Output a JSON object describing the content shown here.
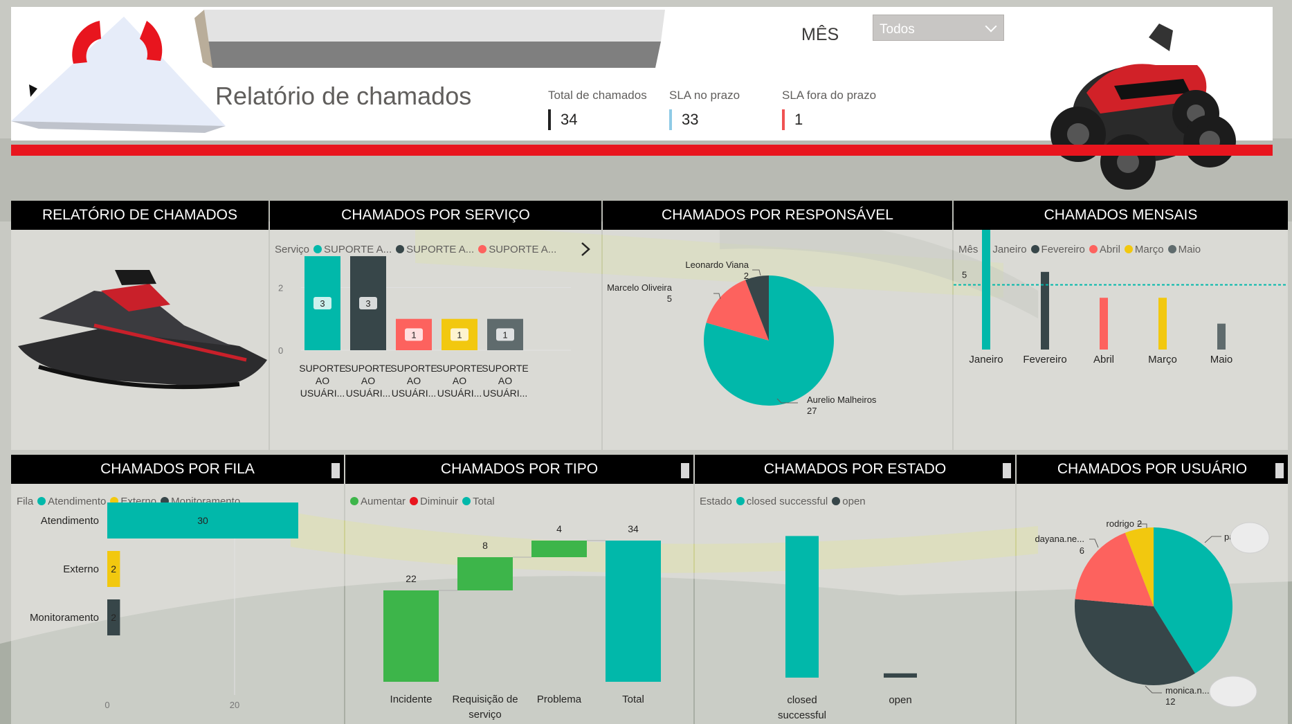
{
  "header": {
    "title": "Relatório de chamados",
    "kpis": [
      {
        "label": "Total de chamados",
        "value": "34",
        "color": "#222222"
      },
      {
        "label": "SLA no prazo",
        "value": "33",
        "color": "#8fcbe6"
      },
      {
        "label": "SLA fora do prazo",
        "value": "1",
        "color": "#f05252"
      }
    ],
    "month_filter": {
      "label": "MÊS",
      "selected": "Todos"
    }
  },
  "colors": {
    "teal": "#01b8aa",
    "dark": "#374649",
    "red": "#fd625e",
    "yellow": "#f2c80f",
    "gray": "#5f6b6d",
    "green": "#3db54a",
    "accent_red": "#e8151e"
  },
  "panels": {
    "jetski": {
      "title": "RELATÓRIO DE CHAMADOS",
      "icon": "jetski-image"
    },
    "servico": {
      "title": "CHAMADOS POR SERVIÇO",
      "legend_title": "Serviço",
      "legend": [
        "SUPORTE A...",
        "SUPORTE A...",
        "SUPORTE A..."
      ]
    },
    "responsavel": {
      "title": "CHAMADOS POR RESPONSÁVEL"
    },
    "mensais": {
      "title": "CHAMADOS MENSAIS",
      "legend_title": "Mês",
      "legend": [
        "Janeiro",
        "Fevereiro",
        "Abril",
        "Março",
        "Maio"
      ]
    },
    "fila": {
      "title": "CHAMADOS POR FILA",
      "legend_title": "Fila",
      "legend": [
        "Atendimento",
        "Externo",
        "Monitoramento"
      ]
    },
    "tipo": {
      "title": "CHAMADOS POR TIPO",
      "legend": [
        "Aumentar",
        "Diminuir",
        "Total"
      ]
    },
    "estado": {
      "title": "CHAMADOS POR ESTADO",
      "legend_title": "Estado",
      "legend": [
        "closed successful",
        "open"
      ]
    },
    "usuario": {
      "title": "CHAMADOS POR USUÁRIO"
    }
  },
  "chart_data": [
    {
      "id": "servico",
      "type": "bar",
      "categories": [
        "SUPORTE AO USUÁRI...",
        "SUPORTE AO USUÁRI...",
        "SUPORTE AO USUÁRI...",
        "SUPORTE AO USUÁRI...",
        "SUPORTE AO USUÁRI..."
      ],
      "category_lines": [
        [
          "SUPORTE",
          "AO",
          "USUÁRI..."
        ],
        [
          "SUPORTE",
          "AO",
          "USUÁRI..."
        ],
        [
          "SUPORTE",
          "AO",
          "USUÁRI..."
        ],
        [
          "SUPORTE",
          "AO",
          "USUÁRI..."
        ],
        [
          "SUPORTE",
          "AO",
          "USUÁRI..."
        ]
      ],
      "values": [
        3,
        3,
        1,
        1,
        1
      ],
      "colors": [
        "#01b8aa",
        "#374649",
        "#fd625e",
        "#f2c80f",
        "#5f6b6d"
      ],
      "yticks": [
        "0",
        "2"
      ],
      "ylim": [
        0,
        3
      ]
    },
    {
      "id": "responsavel",
      "type": "pie",
      "labels": [
        "Aurelio Malheiros",
        "Marcelo Oliveira",
        "Leonardo Viana"
      ],
      "values": [
        27,
        5,
        2
      ],
      "colors": [
        "#01b8aa",
        "#fd625e",
        "#374649"
      ]
    },
    {
      "id": "mensais",
      "type": "bar",
      "categories": [
        "Janeiro",
        "Fevereiro",
        "Abril",
        "Março",
        "Maio"
      ],
      "values": [
        10,
        6,
        4,
        4,
        2
      ],
      "colors": [
        "#01b8aa",
        "#374649",
        "#fd625e",
        "#f2c80f",
        "#5f6b6d"
      ],
      "reference_line": 5,
      "yticks": [
        "5"
      ],
      "ylim": [
        0,
        10
      ]
    },
    {
      "id": "fila",
      "type": "bar",
      "orientation": "horizontal",
      "categories": [
        "Atendimento",
        "Externo",
        "Monitoramento"
      ],
      "values": [
        30,
        2,
        2
      ],
      "colors": [
        "#01b8aa",
        "#f2c80f",
        "#374649"
      ],
      "xticks": [
        "0",
        "20"
      ],
      "xlim": [
        0,
        30
      ]
    },
    {
      "id": "tipo",
      "type": "bar",
      "subtype": "waterfall",
      "categories": [
        "Incidente",
        "Requisição de serviço",
        "Problema",
        "Total"
      ],
      "category_lines": [
        [
          "Incidente"
        ],
        [
          "Requisição de",
          "serviço"
        ],
        [
          "Problema"
        ],
        [
          "Total"
        ]
      ],
      "values": [
        22,
        8,
        4,
        34
      ],
      "kinds": [
        "Aumentar",
        "Aumentar",
        "Aumentar",
        "Total"
      ],
      "colors": [
        "#3db54a",
        "#3db54a",
        "#3db54a",
        "#01b8aa"
      ]
    },
    {
      "id": "estado",
      "type": "bar",
      "categories": [
        "closed successful",
        "open"
      ],
      "category_lines": [
        [
          "closed",
          "successful"
        ],
        [
          "open"
        ]
      ],
      "values": [
        33,
        1
      ],
      "colors": [
        "#01b8aa",
        "#374649"
      ]
    },
    {
      "id": "usuario",
      "type": "pie",
      "labels": [
        "pa...",
        "monica.n...",
        "dayana.ne...",
        "rodrigo"
      ],
      "values": [
        14,
        12,
        6,
        2
      ],
      "colors": [
        "#01b8aa",
        "#374649",
        "#fd625e",
        "#f2c80f"
      ]
    }
  ]
}
